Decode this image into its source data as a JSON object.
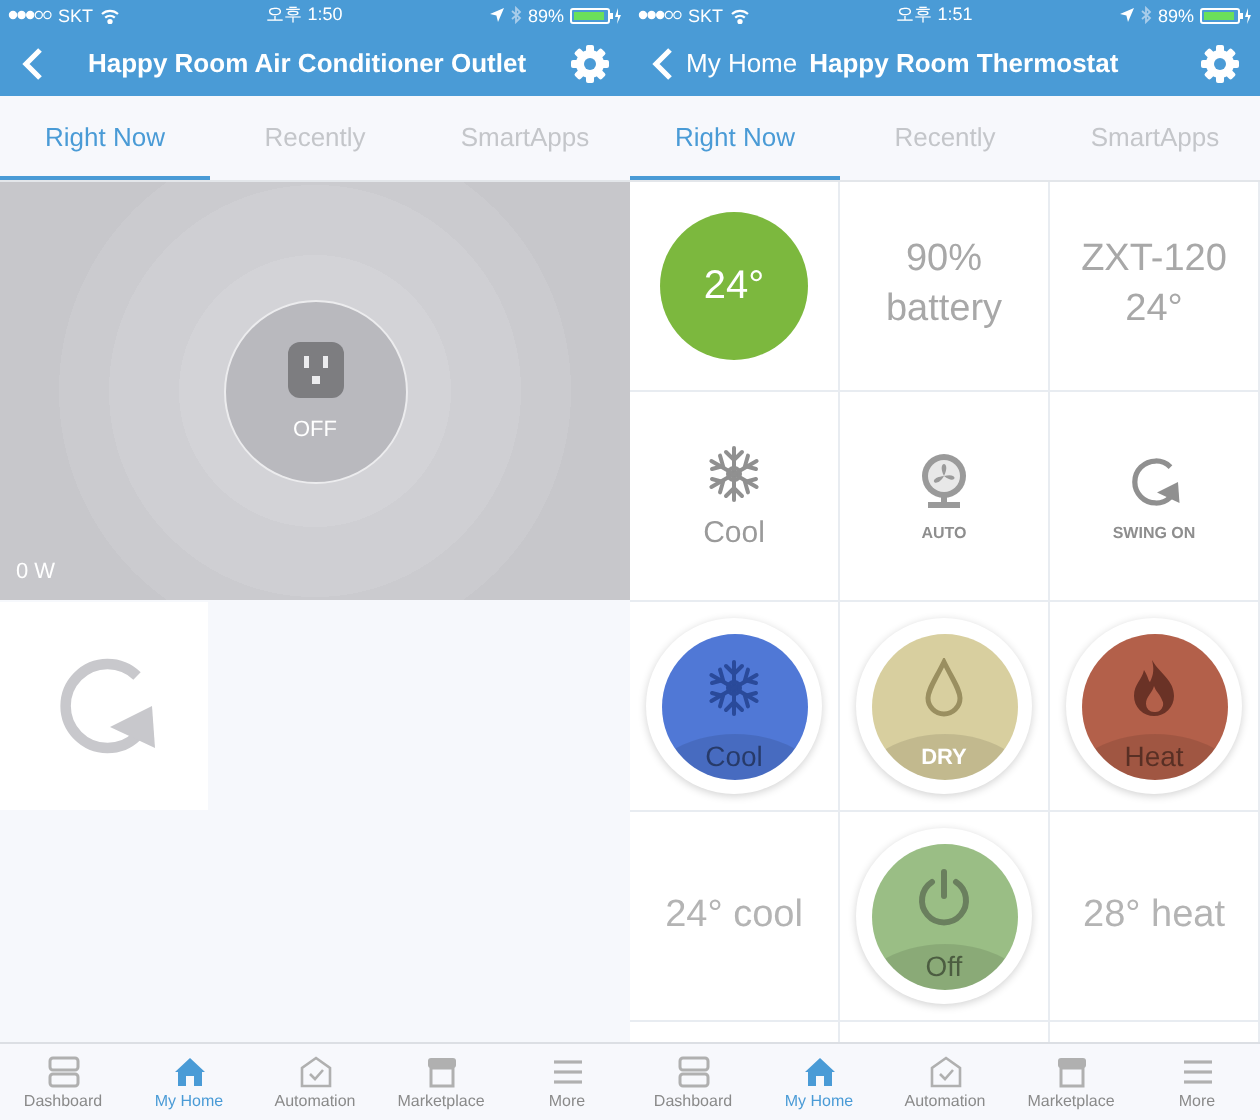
{
  "screens": [
    {
      "status_bar": {
        "carrier": "SKT",
        "time": "오후 1:50",
        "battery": "89%"
      },
      "header": {
        "title": "Happy Room Air Conditioner Outlet"
      },
      "tabs": [
        {
          "label": "Right Now",
          "selected": true
        },
        {
          "label": "Recently",
          "selected": false
        },
        {
          "label": "SmartApps",
          "selected": false
        }
      ],
      "tiles": [
        {
          "kind": "outlet",
          "state": "OFF",
          "power": "0 W"
        },
        {
          "kind": "refresh"
        }
      ],
      "nav": [
        {
          "label": "Dashboard",
          "selected": false
        },
        {
          "label": "My Home",
          "selected": true
        },
        {
          "label": "Automation",
          "selected": false
        },
        {
          "label": "Marketplace",
          "selected": false
        },
        {
          "label": "More",
          "selected": false
        }
      ]
    },
    {
      "status_bar": {
        "carrier": "SKT",
        "time": "오후 1:51",
        "battery": "89%"
      },
      "header": {
        "back_label": "My Home",
        "title": "Happy Room Thermostat"
      },
      "tabs": [
        {
          "label": "Right Now",
          "selected": true
        },
        {
          "label": "Recently",
          "selected": false
        },
        {
          "label": "SmartApps",
          "selected": false
        }
      ],
      "tiles": [
        {
          "kind": "temperature",
          "value": "24°",
          "color": "#7cb83e"
        },
        {
          "kind": "reading",
          "text": "90% battery"
        },
        {
          "kind": "reading",
          "text": "ZXT-120 24°"
        },
        {
          "kind": "mode",
          "label": "Cool"
        },
        {
          "kind": "fan",
          "label": "AUTO"
        },
        {
          "kind": "swing",
          "label": "SWING ON"
        },
        {
          "kind": "cool",
          "label": "Cool",
          "color": "#5078d6"
        },
        {
          "kind": "dry",
          "label": "DRY",
          "color": "#d8cf9f"
        },
        {
          "kind": "heat",
          "label": "Heat",
          "color": "#b3604a"
        },
        {
          "kind": "setpoint",
          "text": "24° cool"
        },
        {
          "kind": "off",
          "label": "Off",
          "color": "#9abe85"
        },
        {
          "kind": "setpoint",
          "text": "28° heat"
        }
      ],
      "nav": [
        {
          "label": "Dashboard",
          "selected": false
        },
        {
          "label": "My Home",
          "selected": true
        },
        {
          "label": "Automation",
          "selected": false
        },
        {
          "label": "Marketplace",
          "selected": false
        },
        {
          "label": "More",
          "selected": false
        }
      ]
    }
  ]
}
